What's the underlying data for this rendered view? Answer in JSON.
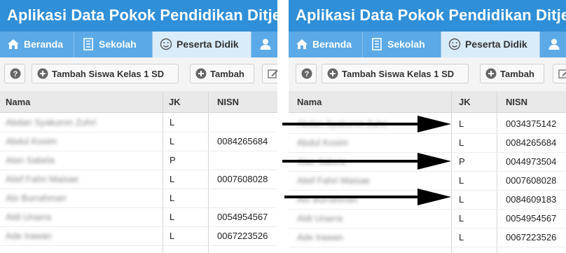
{
  "app": {
    "title": "Aplikasi Data Pokok Pendidikan Ditjen"
  },
  "nav": {
    "items": [
      {
        "label": "Beranda",
        "icon": "home-icon"
      },
      {
        "label": "Sekolah",
        "icon": "building-icon"
      },
      {
        "label": "Peserta Didik",
        "icon": "smiley-icon",
        "active": true
      },
      {
        "label": "",
        "icon": "user-icon"
      }
    ]
  },
  "toolbar": {
    "help_icon": "question-icon",
    "add_grade1_label": "Tambah Siswa Kelas 1 SD",
    "add_label": "Tambah",
    "edit_icon": "edit-icon"
  },
  "grid": {
    "columns": [
      "Nama",
      "JK",
      "NISN"
    ],
    "left_rows": [
      {
        "name": "Abdan Syakuron Zuhri",
        "jk": "L",
        "nisn": ""
      },
      {
        "name": "Abdul Kosim",
        "jk": "L",
        "nisn": "0084265684"
      },
      {
        "name": "Alan Sabela",
        "jk": "P",
        "nisn": ""
      },
      {
        "name": "Alief Fahri Maisae",
        "jk": "L",
        "nisn": "0007608028"
      },
      {
        "name": "Alo Burrahman",
        "jk": "L",
        "nisn": ""
      },
      {
        "name": "Aldi Unarra",
        "jk": "L",
        "nisn": "0054954567"
      },
      {
        "name": "Ade Irawan",
        "jk": "L",
        "nisn": "0067223526"
      }
    ],
    "right_rows": [
      {
        "name": "Abdan Syakuron Zuhri",
        "jk": "L",
        "nisn": "0034375142"
      },
      {
        "name": "Abdul Kosim",
        "jk": "L",
        "nisn": "0084265684"
      },
      {
        "name": "Alan Sabela",
        "jk": "P",
        "nisn": "0044973504"
      },
      {
        "name": "Alief Fahri Maisae",
        "jk": "L",
        "nisn": "0007608028"
      },
      {
        "name": "Alo Burrahman",
        "jk": "L",
        "nisn": "0084609183"
      },
      {
        "name": "Aldi Unarra",
        "jk": "L",
        "nisn": "0054954567"
      },
      {
        "name": "Ade Irawan",
        "jk": "L",
        "nisn": "0067223526"
      }
    ]
  },
  "colors": {
    "title_bar": "#2f8fd8",
    "nav_bar": "#5ba9e6",
    "active_tab": "#d9ecfa",
    "arrow": "#000000"
  }
}
